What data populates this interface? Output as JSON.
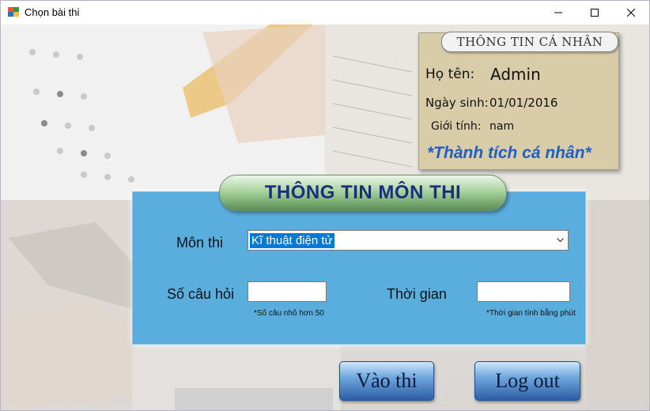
{
  "window": {
    "title": "Chọn bài thi"
  },
  "profile": {
    "title": "THÔNG TIN CÁ NHÂN",
    "name_label": "Họ tên:",
    "name_value": "Admin",
    "dob_label": "Ngày sinh:",
    "dob_value": "01/01/2016",
    "gender_label": "Giới tính:",
    "gender_value": "nam",
    "achievements_link": "*Thành tích cá nhân*"
  },
  "exam_info": {
    "title": "THÔNG TIN MÔN THI",
    "subject_label": "Môn thi",
    "subject_selected": "Kĩ thuật điện tử",
    "questions_label": "Số câu hỏi",
    "questions_value": "",
    "questions_hint": "*Số câu nhỏ hơn 50",
    "time_label": "Thời gian",
    "time_value": "",
    "time_hint": "*Thời gian tính bằng phút"
  },
  "buttons": {
    "enter_exam": "Vào thi",
    "logout": "Log out"
  },
  "colors": {
    "panel": "#5aaede",
    "selection": "#0078d7",
    "achievements": "#1f5fc7",
    "button": "#4f86c6"
  }
}
